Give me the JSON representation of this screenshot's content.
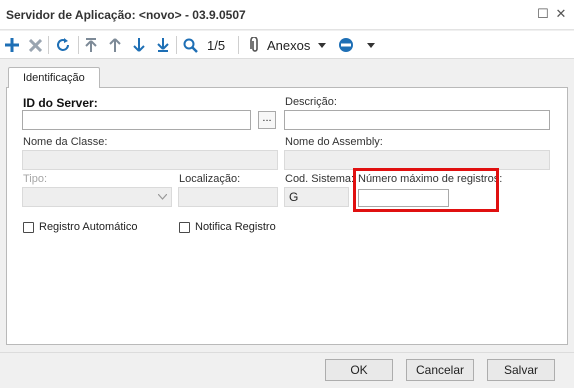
{
  "window": {
    "title": "Servidor de Aplicação: <novo> - 03.9.0507",
    "restore_glyph": "☐",
    "close_glyph": "✕"
  },
  "toolbar": {
    "position": "1/5",
    "attachments_label": "Anexos",
    "icons": [
      "plus-icon",
      "delete-icon",
      "refresh-icon",
      "first-record-icon",
      "previous-record-icon",
      "next-record-icon",
      "last-record-icon",
      "search-icon",
      "paperclip-icon",
      "link-icon"
    ],
    "accent_color": "#1e6fb5"
  },
  "tabs": [
    {
      "label": "Identificação"
    }
  ],
  "form": {
    "id_server_label": "ID do Server:",
    "id_server_value": "",
    "ellipsis_label": "...",
    "descricao_label": "Descrição:",
    "descricao_value": "",
    "nome_classe_label": "Nome da Classe:",
    "nome_classe_value": "",
    "nome_assembly_label": "Nome do Assembly:",
    "nome_assembly_value": "",
    "tipo_label": "Tipo:",
    "tipo_value": "",
    "localizacao_label": "Localização:",
    "localizacao_value": "",
    "cod_sistema_label": "Cod. Sistema:",
    "cod_sistema_value": "G",
    "num_max_registros_label": "Número máximo de registros:",
    "num_max_registros_value": "",
    "registro_automatico_label": "Registro Automático",
    "notifica_registro_label": "Notifica Registro",
    "highlight_color": "#e01010"
  },
  "footer": {
    "ok_label": "OK",
    "cancel_label": "Cancelar",
    "save_label": "Salvar"
  }
}
